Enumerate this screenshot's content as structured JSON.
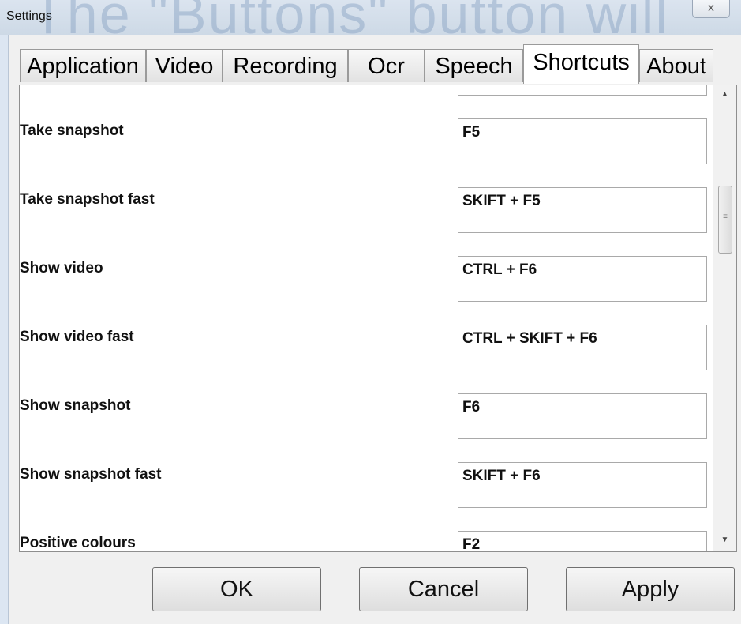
{
  "window": {
    "title": "Settings",
    "background_ghost_text": "The \"Buttons\" button will",
    "close_label": "x"
  },
  "tabs": [
    {
      "label": "Application",
      "active": false
    },
    {
      "label": "Video",
      "active": false
    },
    {
      "label": "Recording",
      "active": false
    },
    {
      "label": "Ocr",
      "active": false
    },
    {
      "label": "Speech",
      "active": false
    },
    {
      "label": "Shortcuts",
      "active": true
    },
    {
      "label": "About",
      "active": false
    }
  ],
  "shortcuts": [
    {
      "label": "",
      "value": ""
    },
    {
      "label": "Take snapshot",
      "value": "F5"
    },
    {
      "label": "Take snapshot fast",
      "value": "SKIFT + F5"
    },
    {
      "label": "Show video",
      "value": "CTRL + F6"
    },
    {
      "label": "Show video fast",
      "value": "CTRL + SKIFT + F6"
    },
    {
      "label": "Show snapshot",
      "value": "F6"
    },
    {
      "label": "Show snapshot fast",
      "value": "SKIFT + F6"
    },
    {
      "label": "Positive colours",
      "value": "F2"
    }
  ],
  "scrollbar": {
    "up_icon": "up-arrow-icon",
    "down_icon": "down-arrow-icon",
    "up_glyph": "▲",
    "down_glyph": "▼",
    "grip_glyph": "≡"
  },
  "buttons": {
    "ok_label": "OK",
    "cancel_label": "Cancel",
    "apply_label": "Apply"
  }
}
